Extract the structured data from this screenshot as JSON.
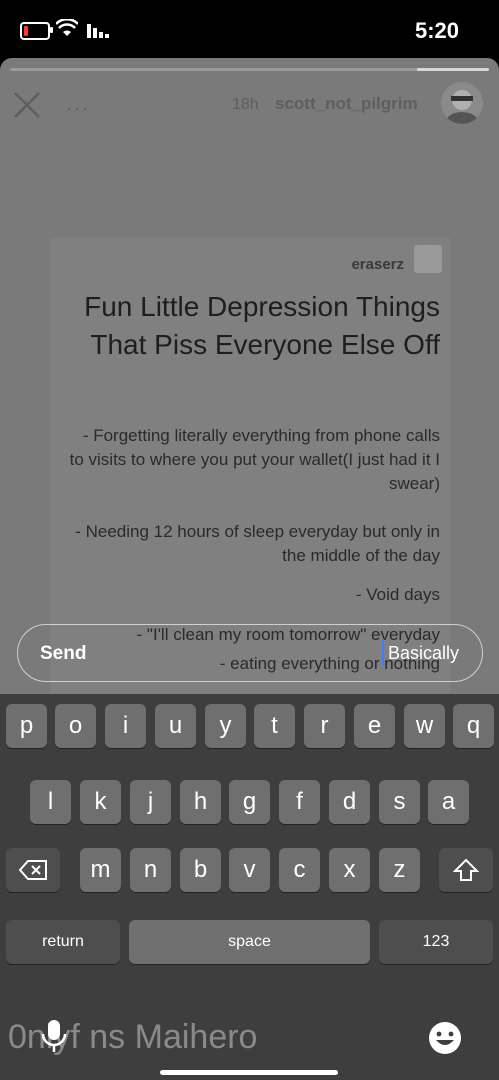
{
  "status": {
    "time": "5:20"
  },
  "story": {
    "username": "scott_not_pilgrim",
    "time_ago": "18h",
    "more": "···",
    "progress_fraction": 0.15
  },
  "post": {
    "author": "eraserz",
    "title": "Fun Little Depression Things That Piss Everyone Else Off",
    "items": [
      "- Forgetting literally everything from phone calls to visits to where you put your wallet(I just had it I swear)",
      "- Needing 12 hours of sleep everyday but only in the middle of the day",
      "- Void days",
      "- \"I'll clean my room tomorrow\" everyday",
      "- eating everything or nothing"
    ]
  },
  "reply": {
    "text": "Basically",
    "send_label": "Send"
  },
  "keyboard": {
    "row1": [
      "q",
      "w",
      "e",
      "r",
      "t",
      "y",
      "u",
      "i",
      "o",
      "p"
    ],
    "row2": [
      "a",
      "s",
      "d",
      "f",
      "g",
      "h",
      "j",
      "k",
      "l"
    ],
    "row3": [
      "z",
      "x",
      "c",
      "v",
      "b",
      "n",
      "m"
    ],
    "numbers_label": "123",
    "space_label": "space",
    "return_label": "return"
  },
  "dictation": {
    "text": "0nlyf ns Maihero"
  }
}
